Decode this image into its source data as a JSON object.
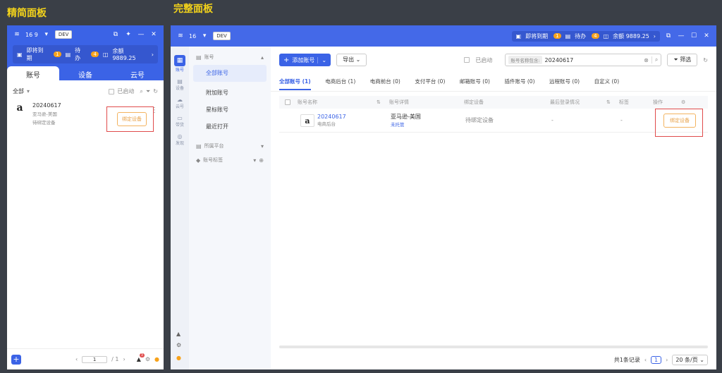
{
  "captions": {
    "compact": "精简面板",
    "full": "完整面板"
  },
  "compact": {
    "account_id": "16        9",
    "dev": "DEV",
    "expiring": "即将到期",
    "expiring_count": "1",
    "todo": "待办",
    "todo_count": "4",
    "balance": "余额 9889.25",
    "tabs": [
      "账号",
      "设备",
      "云号"
    ],
    "filter_all": "全部",
    "launched": "已启动",
    "item": {
      "name": "20240617",
      "region": "亚马逊-美国",
      "status": "待绑定设备"
    },
    "bind_label": "绑定设备",
    "page_value": "1",
    "page_total": "/ 1",
    "notif_count": "3"
  },
  "full": {
    "account_id": "16        ",
    "dev": "DEV",
    "expiring": "即将到期",
    "expiring_count": "1",
    "todo": "待办",
    "todo_count": "4",
    "balance": "余额 9889.25",
    "rail": [
      "账号",
      "设备",
      "云号",
      "带货",
      "发现"
    ],
    "group_header": "账号",
    "menu": [
      "全部账号",
      "附加账号",
      "星标账号",
      "最近打开"
    ],
    "platform": "所属平台",
    "tags": "账号标签",
    "add_account": "添加账号",
    "export": "导出",
    "launched": "已启动",
    "search_label": "账号名称包含:",
    "search_value": "20240617",
    "filter": "筛选",
    "tabs": [
      "全部账号 (1)",
      "电商后台 (1)",
      "电商前台 (0)",
      "支付平台 (0)",
      "邮箱账号 (0)",
      "插件账号 (0)",
      "远程账号 (0)",
      "自定义 (0)"
    ],
    "columns": [
      "账号名称",
      "账号详情",
      "绑定设备",
      "最后登录情况",
      "标签",
      "操作"
    ],
    "row": {
      "name": "20240617",
      "type": "电商后台",
      "detail": "亚马逊-美国",
      "detail_sub": "未托管",
      "device": "待绑定设备",
      "last": "-",
      "tag": "-"
    },
    "bind_label": "绑定设备",
    "total": "共1条记录",
    "page": "1",
    "page_size": "20 条/页"
  }
}
